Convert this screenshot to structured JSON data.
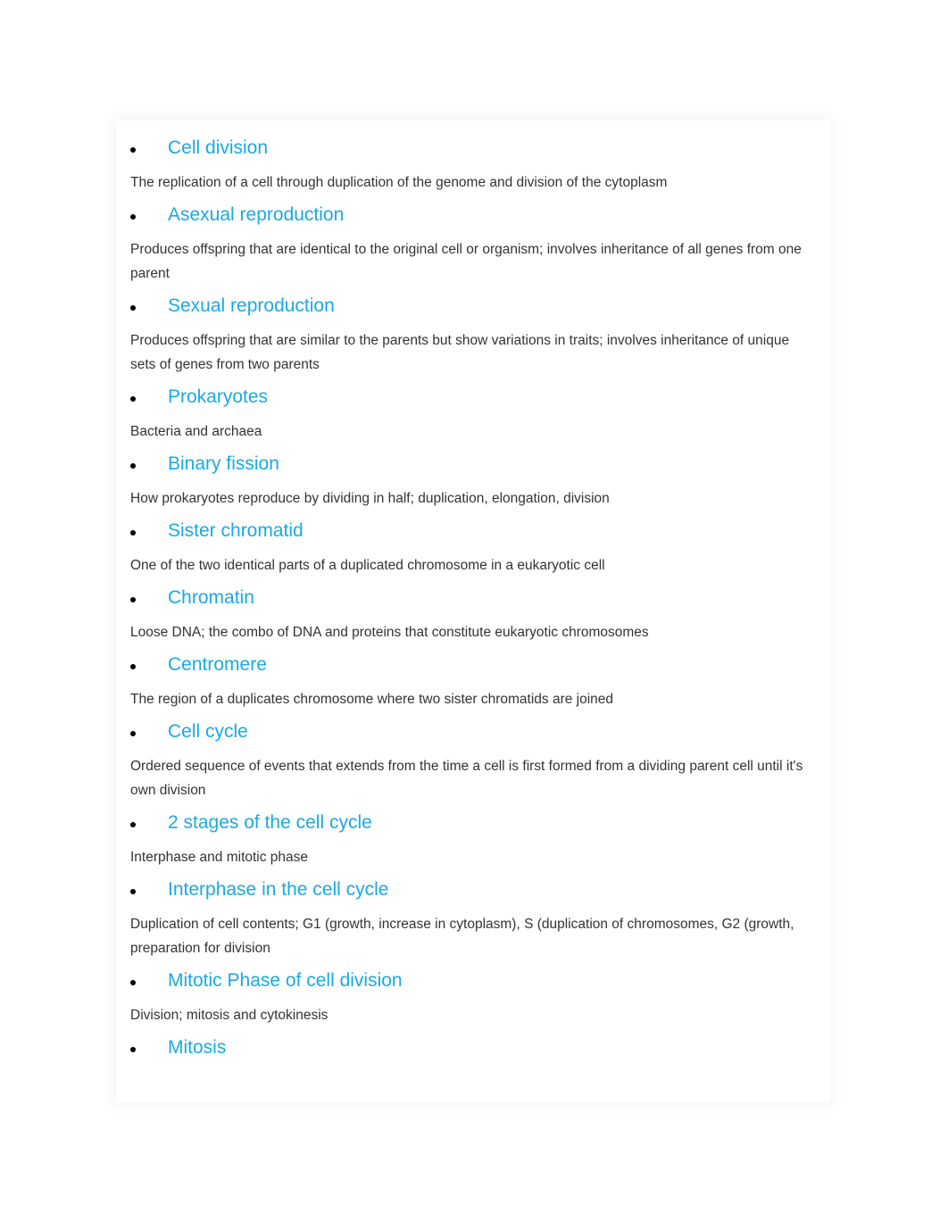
{
  "document": {
    "entries": [
      {
        "term": "Cell division",
        "definition": "The replication of a cell through duplication of the genome and division of the cytoplasm"
      },
      {
        "term": "Asexual reproduction",
        "definition": "Produces offspring that are identical to the original cell or organism; involves inheritance of all genes from one parent"
      },
      {
        "term": "Sexual reproduction",
        "definition": "Produces offspring that are similar to the parents but show variations in traits; involves inheritance of unique sets of genes from two parents"
      },
      {
        "term": "Prokaryotes",
        "definition": "Bacteria and archaea"
      },
      {
        "term": "Binary fission",
        "definition": "How prokaryotes reproduce by dividing in half; duplication, elongation, division"
      },
      {
        "term": "Sister chromatid",
        "definition": "One of the two identical parts of a duplicated chromosome in a eukaryotic cell"
      },
      {
        "term": "Chromatin",
        "definition": "Loose DNA; the combo of DNA and proteins that constitute eukaryotic chromosomes"
      },
      {
        "term": "Centromere",
        "definition": "The region of a duplicates chromosome where two sister chromatids are joined"
      },
      {
        "term": "Cell cycle",
        "definition": "Ordered sequence of events that extends from the time a cell is first formed from a dividing parent cell until it's own division"
      },
      {
        "term": "2 stages of the cell cycle",
        "definition": "Interphase and mitotic phase"
      },
      {
        "term": "Interphase in the cell cycle",
        "definition": "Duplication of cell contents; G1 (growth, increase in cytoplasm), S (duplication of chromosomes, G2 (growth, preparation for division"
      },
      {
        "term": "Mitotic Phase of cell division",
        "definition": "Division; mitosis and cytokinesis"
      },
      {
        "term": "Mitosis",
        "definition": null
      }
    ]
  },
  "colors": {
    "term": "#1aa9e3",
    "definition": "#333333",
    "background": "#ffffff"
  }
}
